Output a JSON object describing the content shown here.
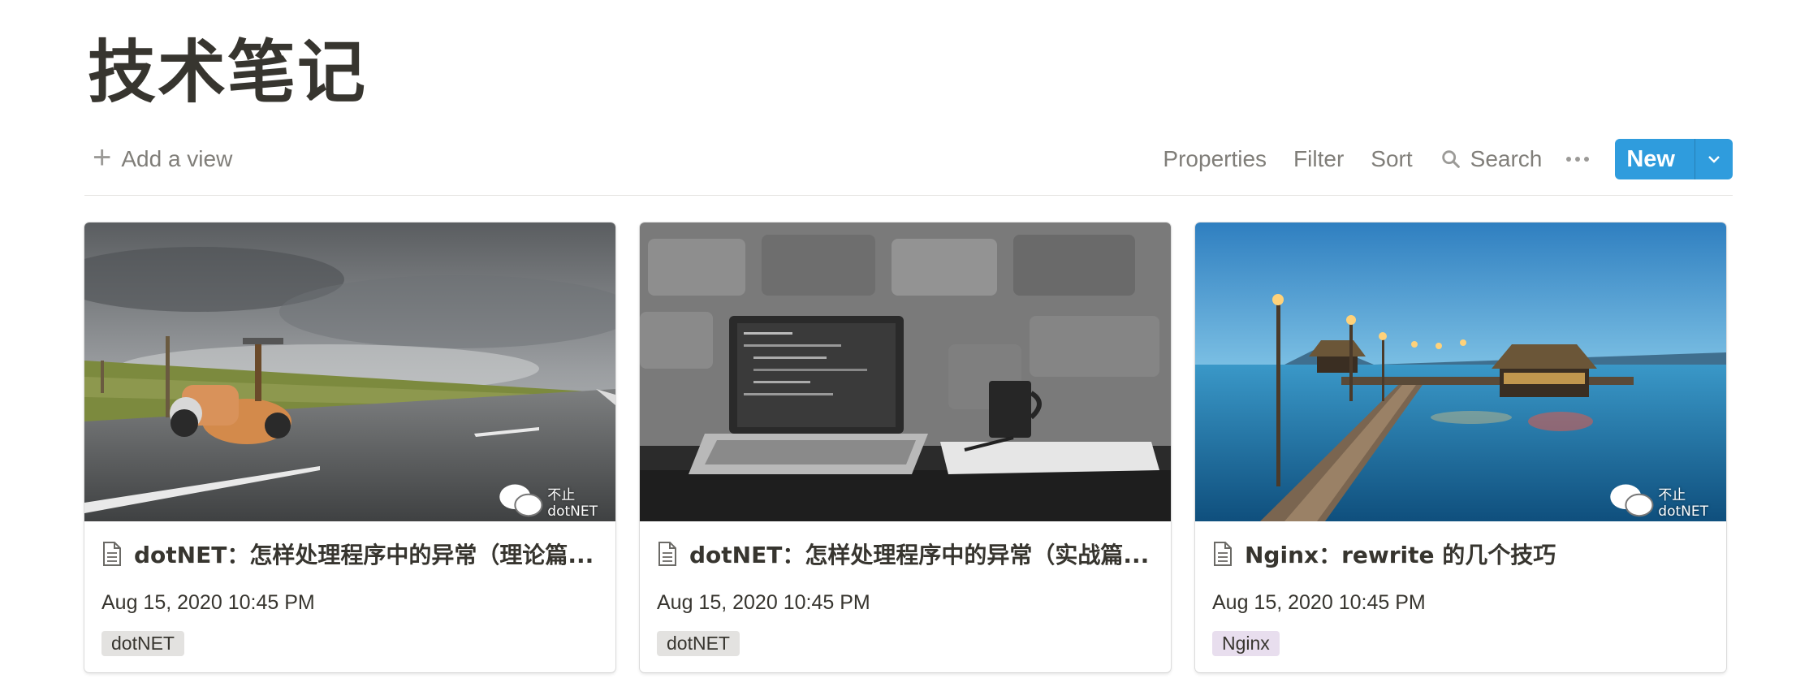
{
  "page": {
    "title": "技术笔记"
  },
  "toolbar": {
    "add_view": "Add a view",
    "properties": "Properties",
    "filter": "Filter",
    "sort": "Sort",
    "search": "Search",
    "new": "New"
  },
  "colors": {
    "accent": "#2f9cdd",
    "tag_gray": "#e3e2e0",
    "tag_purple": "#e8deee"
  },
  "cards": [
    {
      "title": "dotNET：怎样处理程序中的异常（理论篇...",
      "date": "Aug 15, 2020 10:45 PM",
      "tag": "dotNET",
      "watermark": "不止dotNET"
    },
    {
      "title": "dotNET：怎样处理程序中的异常（实战篇...",
      "date": "Aug 15, 2020 10:45 PM",
      "tag": "dotNET",
      "watermark": ""
    },
    {
      "title": "Nginx：rewrite 的几个技巧",
      "date": "Aug 15, 2020 10:45 PM",
      "tag": "Nginx",
      "watermark": "不止dotNET"
    }
  ]
}
